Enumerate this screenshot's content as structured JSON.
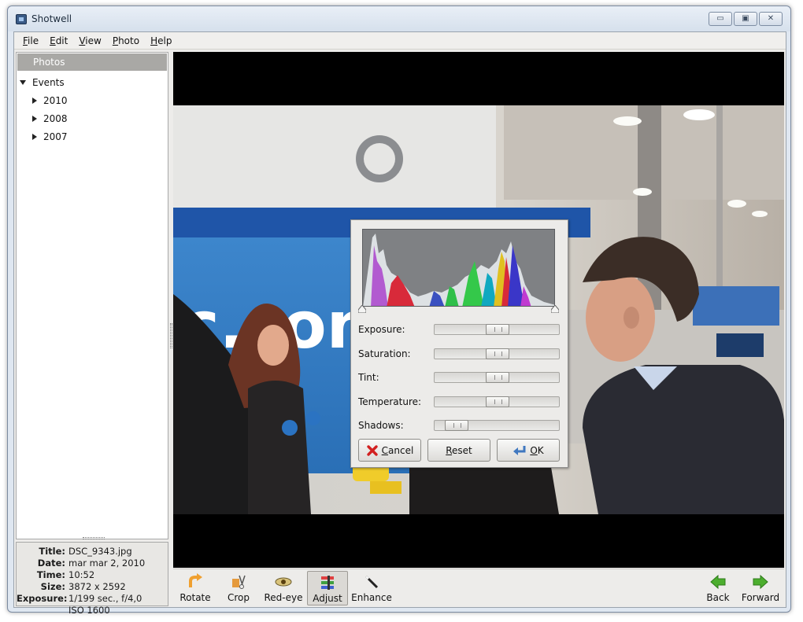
{
  "window": {
    "title": "Shotwell"
  },
  "menubar": {
    "items": [
      {
        "label": "File",
        "mnemonic": "F",
        "rest": "ile"
      },
      {
        "label": "Edit",
        "mnemonic": "E",
        "rest": "dit"
      },
      {
        "label": "View",
        "mnemonic": "V",
        "rest": "iew"
      },
      {
        "label": "Photo",
        "mnemonic": "P",
        "rest": "hoto"
      },
      {
        "label": "Help",
        "mnemonic": "H",
        "rest": "elp"
      }
    ]
  },
  "sidebar": {
    "photos_label": "Photos",
    "events_label": "Events",
    "years": [
      "2010",
      "2008",
      "2007"
    ]
  },
  "info": {
    "title_label": "Title:",
    "title": "DSC_9343.jpg",
    "date_label": "Date:",
    "date": "mar mar 2, 2010",
    "time_label": "Time:",
    "time": "10:52",
    "size_label": "Size:",
    "size": "3872 x 2592",
    "exposure_label": "Exposure:",
    "exposure": "1/199 sec., f/4,0",
    "iso": "ISO 1600"
  },
  "adjust": {
    "sliders": [
      {
        "label": "Exposure:",
        "value": 0.5
      },
      {
        "label": "Saturation:",
        "value": 0.5
      },
      {
        "label": "Tint:",
        "value": 0.5
      },
      {
        "label": "Temperature:",
        "value": 0.5
      },
      {
        "label": "Shadows:",
        "value": 0.1
      }
    ],
    "cancel": {
      "label": "Cancel",
      "mnemonic": "C",
      "rest": "ancel"
    },
    "reset": {
      "label": "Reset",
      "mnemonic": "R",
      "rest": "eset"
    },
    "ok": {
      "label": "OK",
      "mnemonic": "O",
      "rest": "K"
    }
  },
  "toolbar": {
    "rotate": "Rotate",
    "crop": "Crop",
    "redeye": "Red-eye",
    "adjust": "Adjust",
    "enhance": "Enhance",
    "back": "Back",
    "forward": "Forward"
  },
  "colors": {
    "sidebar_header": "#a9a8a5",
    "nav_arrow": "#4cae2e",
    "rotate_arrow": "#f0a030",
    "cancel_red": "#d22020"
  }
}
